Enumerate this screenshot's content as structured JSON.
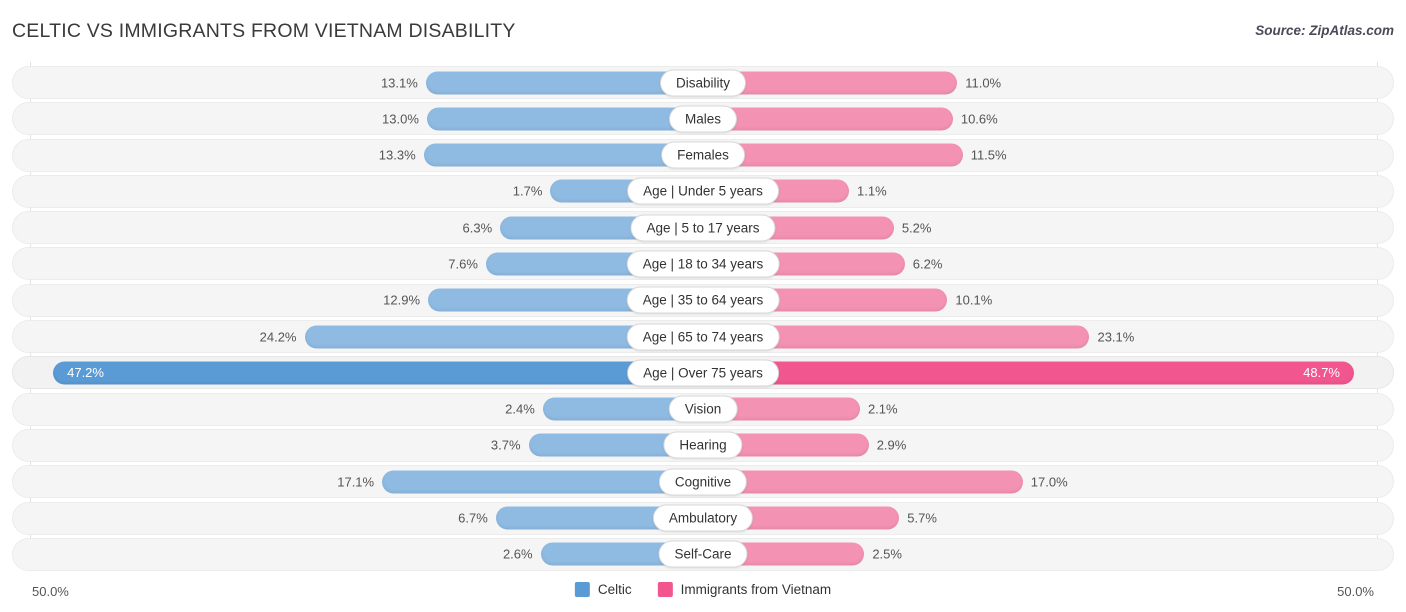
{
  "header": {
    "title": "CELTIC VS IMMIGRANTS FROM VIETNAM DISABILITY",
    "source": "Source: ZipAtlas.com"
  },
  "footer": {
    "axis_left": "50.0%",
    "axis_right": "50.0%",
    "legend": [
      {
        "label": "Celtic",
        "color": "#5b9bd5"
      },
      {
        "label": "Immigrants from Vietnam",
        "color": "#f2568f"
      }
    ]
  },
  "colors": {
    "left_bar": "#8fbbe3",
    "right_bar": "#f492b4",
    "left_bar_highlight": "#5b9bd5",
    "right_bar_highlight": "#f2568f",
    "row_background": "#f5f5f5",
    "gridline": "#e2e2e2"
  },
  "chart_data": {
    "type": "bar",
    "subtype": "diverging-bidirectional",
    "title": "CELTIC VS IMMIGRANTS FROM VIETNAM DISABILITY",
    "xlabel": "",
    "ylabel": "",
    "xlim": [
      50.0,
      50.0
    ],
    "axis_tick_labels": [
      "50.0%",
      "50.0%"
    ],
    "grid": true,
    "legend_position": "bottom-center",
    "categories": [
      "Disability",
      "Males",
      "Females",
      "Age | Under 5 years",
      "Age | 5 to 17 years",
      "Age | 18 to 34 years",
      "Age | 35 to 64 years",
      "Age | 65 to 74 years",
      "Age | Over 75 years",
      "Vision",
      "Hearing",
      "Cognitive",
      "Ambulatory",
      "Self-Care"
    ],
    "series": [
      {
        "name": "Celtic",
        "side": "left",
        "color": "#8fbbe3",
        "values": [
          13.1,
          13.0,
          13.3,
          1.7,
          6.3,
          7.6,
          12.9,
          24.2,
          47.2,
          2.4,
          3.7,
          17.1,
          6.7,
          2.6
        ],
        "labels": [
          "13.1%",
          "13.0%",
          "13.3%",
          "1.7%",
          "6.3%",
          "7.6%",
          "12.9%",
          "24.2%",
          "47.2%",
          "2.4%",
          "3.7%",
          "17.1%",
          "6.7%",
          "2.6%"
        ]
      },
      {
        "name": "Immigrants from Vietnam",
        "side": "right",
        "color": "#f492b4",
        "values": [
          11.0,
          10.6,
          11.5,
          1.1,
          5.2,
          6.2,
          10.1,
          23.1,
          48.7,
          2.1,
          2.9,
          17.0,
          5.7,
          2.5
        ],
        "labels": [
          "11.0%",
          "10.6%",
          "11.5%",
          "1.1%",
          "5.2%",
          "6.2%",
          "10.1%",
          "23.1%",
          "48.7%",
          "2.1%",
          "2.9%",
          "17.0%",
          "5.7%",
          "2.5%"
        ]
      }
    ],
    "highlighted_category": "Age | Over 75 years"
  }
}
